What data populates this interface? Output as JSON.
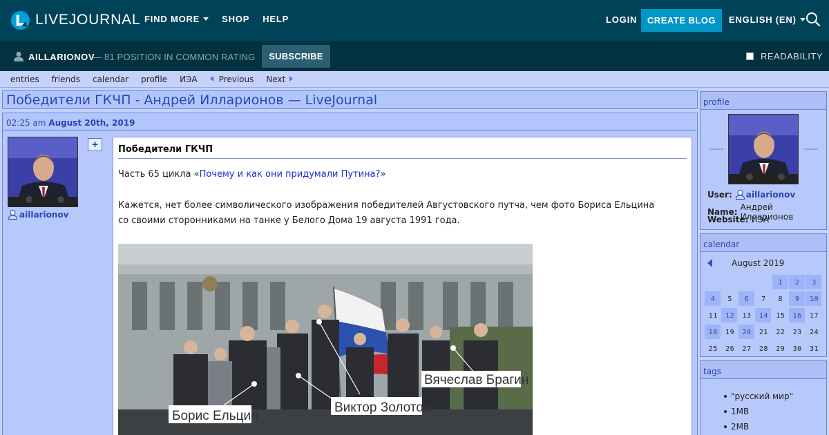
{
  "header": {
    "logo_text": "LIVEJOURNAL",
    "nav": [
      "FIND MORE",
      "SHOP",
      "HELP"
    ],
    "login": "LOGIN",
    "create_blog": "CREATE BLOG",
    "language": "ENGLISH (EN)"
  },
  "subheader": {
    "journal_name": "AILLARIONOV",
    "rating": "— 81 POSITION IN COMMON RATING",
    "subscribe": "SUBSCRIBE",
    "readability": "READABILITY"
  },
  "journal_nav": {
    "items": [
      "entries",
      "friends",
      "calendar",
      "profile",
      "ИЭА"
    ],
    "previous": "Previous",
    "next": "Next"
  },
  "page_title": "Победители ГКЧП - Андрей Илларионов — LiveJournal",
  "entry": {
    "time": "02:25 am",
    "date": "August 20th, 2019",
    "poster": "aillarionov",
    "subject": "Победители ГКЧП",
    "intro_prefix": "Часть 65 цикла «",
    "intro_link": "Почему и как они придумали Путина?",
    "intro_suffix": "»",
    "paragraph": "Кажется, нет более символического изображения победителей Августовского путча, чем фото Бориса Ельцина со своими сторонниками на танке у Белого Дома 19 августа 1991 года.",
    "photo_labels": [
      "Борис Ельцин",
      "Виктор Золотов",
      "Вячеслав Брагин"
    ]
  },
  "sidebar": {
    "profile": {
      "heading": "profile",
      "user_label": "User:",
      "user": "aillarionov",
      "name_label": "Name:",
      "name": "Андрей Илларионов",
      "website_label": "Website:",
      "website": "ИЭА"
    },
    "calendar": {
      "heading": "calendar",
      "month": "August 2019",
      "days": [
        {
          "d": "",
          "a": false
        },
        {
          "d": "",
          "a": false
        },
        {
          "d": "",
          "a": false
        },
        {
          "d": "",
          "a": false
        },
        {
          "d": "1",
          "a": true
        },
        {
          "d": "2",
          "a": true
        },
        {
          "d": "3",
          "a": true
        },
        {
          "d": "4",
          "a": true
        },
        {
          "d": "5",
          "a": false
        },
        {
          "d": "6",
          "a": true
        },
        {
          "d": "7",
          "a": false
        },
        {
          "d": "8",
          "a": false
        },
        {
          "d": "9",
          "a": true
        },
        {
          "d": "10",
          "a": true
        },
        {
          "d": "11",
          "a": false
        },
        {
          "d": "12",
          "a": true
        },
        {
          "d": "13",
          "a": false
        },
        {
          "d": "14",
          "a": true
        },
        {
          "d": "15",
          "a": false
        },
        {
          "d": "16",
          "a": true
        },
        {
          "d": "17",
          "a": false
        },
        {
          "d": "18",
          "a": true
        },
        {
          "d": "19",
          "a": false
        },
        {
          "d": "20",
          "a": true
        },
        {
          "d": "21",
          "a": false
        },
        {
          "d": "22",
          "a": false
        },
        {
          "d": "23",
          "a": false
        },
        {
          "d": "24",
          "a": false
        },
        {
          "d": "25",
          "a": false
        },
        {
          "d": "26",
          "a": false
        },
        {
          "d": "27",
          "a": false
        },
        {
          "d": "28",
          "a": false
        },
        {
          "d": "29",
          "a": false
        },
        {
          "d": "30",
          "a": false
        },
        {
          "d": "31",
          "a": false
        }
      ]
    },
    "tags": {
      "heading": "tags",
      "items": [
        "\"русский мир\"",
        "1MB",
        "2MB"
      ]
    }
  },
  "colors": {
    "header_bg": "#004359",
    "subheader_bg": "#02313f",
    "accent": "#0096c8",
    "page_bg": "#c5d3fb",
    "link": "#2a45b3"
  }
}
